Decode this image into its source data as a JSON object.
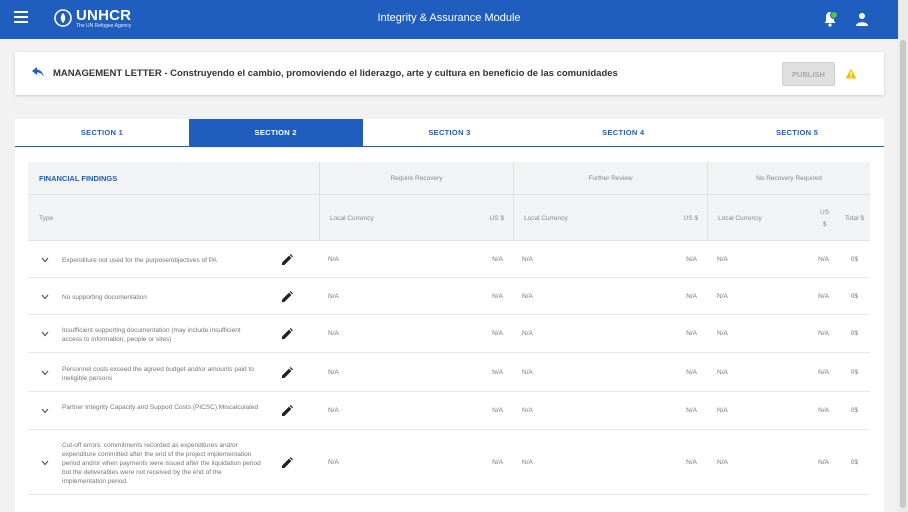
{
  "topbar": {
    "logo_name": "UNHCR",
    "logo_sub": "The UN Refugee Agency",
    "app_title": "Integrity & Assurance Module"
  },
  "header": {
    "title": "MANAGEMENT LETTER - Construyendo el cambio, promoviendo el liderazgo, arte y cultura en beneficio de las comunidades",
    "publish_label": "PUBLISH"
  },
  "tabs": [
    "SECTION 1",
    "SECTION 2",
    "SECTION 3",
    "SECTION 4",
    "SECTION 5"
  ],
  "active_tab": 1,
  "table": {
    "section_title": "FINANCIAL FINDINGS",
    "groups": [
      "Require Recovery",
      "Further Review",
      "No Recovery Required"
    ],
    "col_type": "Type",
    "col_local": "Local Currency",
    "col_usd": "US $",
    "col_usd_a": "US",
    "col_usd_b": "$",
    "col_total": "Total $",
    "rows": [
      {
        "type": "Expenditure not used for the purpose/objectives of PA",
        "rr_local": "N/A",
        "rr_usd": "N/A",
        "fr_local": "N/A",
        "fr_usd": "N/A",
        "nr_local": "N/A",
        "nr_usd": "N/A",
        "total": "0$"
      },
      {
        "type": "No supporting documentation",
        "rr_local": "N/A",
        "rr_usd": "N/A",
        "fr_local": "N/A",
        "fr_usd": "N/A",
        "nr_local": "N/A",
        "nr_usd": "N/A",
        "total": "0$"
      },
      {
        "type": "Insufficient supporting documentation (may include insufficient access to information, people or sites)",
        "rr_local": "N/A",
        "rr_usd": "N/A",
        "fr_local": "N/A",
        "fr_usd": "N/A",
        "nr_local": "N/A",
        "nr_usd": "N/A",
        "total": "0$"
      },
      {
        "type": "Personnel costs exceed the agreed budget and/or amounts paid to ineligible persons",
        "rr_local": "N/A",
        "rr_usd": "N/A",
        "fr_local": "N/A",
        "fr_usd": "N/A",
        "nr_local": "N/A",
        "nr_usd": "N/A",
        "total": "0$"
      },
      {
        "type": "Partner Integrity Capacity and Support Costs (PICSC) Miscalculated",
        "rr_local": "N/A",
        "rr_usd": "N/A",
        "fr_local": "N/A",
        "fr_usd": "N/A",
        "nr_local": "N/A",
        "nr_usd": "N/A",
        "total": "0$"
      },
      {
        "type": "Cut-off errors: commitments recorded as expenditures and/or expenditure committed after the end of the project implementation period and/or when payments were issued after the liquidation period but the deliverables were not received by the end of the implementation period.",
        "rr_local": "N/A",
        "rr_usd": "N/A",
        "fr_local": "N/A",
        "fr_usd": "N/A",
        "nr_local": "N/A",
        "nr_usd": "N/A",
        "total": "0$"
      }
    ]
  },
  "colors": {
    "primary": "#1f5dbf",
    "badge": "#58c34a",
    "warning": "#f5c400"
  }
}
